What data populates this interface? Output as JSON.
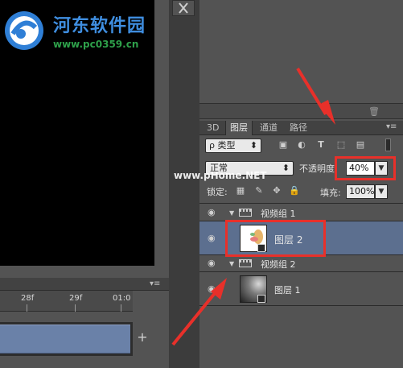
{
  "logo": {
    "name": "河东软件园",
    "url": "www.pc0359.cn"
  },
  "watermark": "www.pHome.NET",
  "timeline": {
    "menu_icon": "panel-menu-icon",
    "ticks": [
      "28f",
      "29f",
      "01:0"
    ],
    "add_label": "+"
  },
  "layers_panel": {
    "tabs": [
      {
        "label": "3D",
        "active": false
      },
      {
        "label": "图层",
        "active": true
      },
      {
        "label": "通道",
        "active": false
      },
      {
        "label": "路径",
        "active": false
      }
    ],
    "filter": {
      "value": "ρ 类型",
      "arrow": "⬍"
    },
    "filter_icons": [
      "image-filter-icon",
      "adjustment-filter-icon",
      "type-filter-icon",
      "shape-filter-icon",
      "smart-object-filter-icon"
    ],
    "blend_mode": {
      "value": "正常",
      "arrow": "⬍"
    },
    "opacity": {
      "label": "不透明度:",
      "value": "40%"
    },
    "lock": {
      "label": "锁定:"
    },
    "fill": {
      "label": "填充:",
      "value": "100%"
    },
    "layers": [
      {
        "type": "group",
        "name": "视频组 1",
        "visible": true
      },
      {
        "type": "layer",
        "name": "图层 2",
        "visible": true,
        "selected": true
      },
      {
        "type": "group",
        "name": "视频组 2",
        "visible": true
      },
      {
        "type": "layer",
        "name": "图层 1",
        "visible": true,
        "selected": false
      }
    ]
  },
  "colors": {
    "highlight": "#e8302a",
    "selected_row": "#5c6f8f",
    "track": "#6a81a8"
  }
}
